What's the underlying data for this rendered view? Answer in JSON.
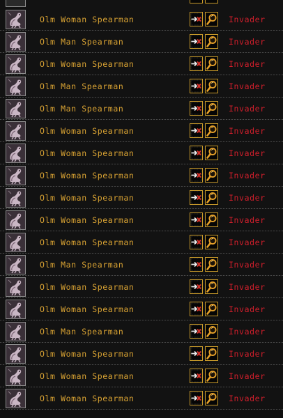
{
  "units": [
    {
      "name": "Olm Woman Spearman",
      "status": "Invader"
    },
    {
      "name": "Olm Man Spearman",
      "status": "Invader"
    },
    {
      "name": "Olm Woman Spearman",
      "status": "Invader"
    },
    {
      "name": "Olm Man Spearman",
      "status": "Invader"
    },
    {
      "name": "Olm Man Spearman",
      "status": "Invader"
    },
    {
      "name": "Olm Woman Spearman",
      "status": "Invader"
    },
    {
      "name": "Olm Woman Spearman",
      "status": "Invader"
    },
    {
      "name": "Olm Woman Spearman",
      "status": "Invader"
    },
    {
      "name": "Olm Woman Spearman",
      "status": "Invader"
    },
    {
      "name": "Olm Woman Spearman",
      "status": "Invader"
    },
    {
      "name": "Olm Woman Spearman",
      "status": "Invader"
    },
    {
      "name": "Olm Man Spearman",
      "status": "Invader"
    },
    {
      "name": "Olm Woman Spearman",
      "status": "Invader"
    },
    {
      "name": "Olm Woman Spearman",
      "status": "Invader"
    },
    {
      "name": "Olm Man Spearman",
      "status": "Invader"
    },
    {
      "name": "Olm Woman Spearman",
      "status": "Invader"
    },
    {
      "name": "Olm Woman Spearman",
      "status": "Invader"
    },
    {
      "name": "Olm Woman Spearman",
      "status": "Invader"
    }
  ],
  "icons": {
    "portrait": "olm-creature-portrait-icon",
    "goto": "go-to-unit-arrow-icon",
    "zoom": "magnifying-glass-icon"
  },
  "colors": {
    "name_text": "#d8a233",
    "status_invader": "#d21f2c",
    "button_border": "#c89a2a",
    "background": "#121212"
  }
}
